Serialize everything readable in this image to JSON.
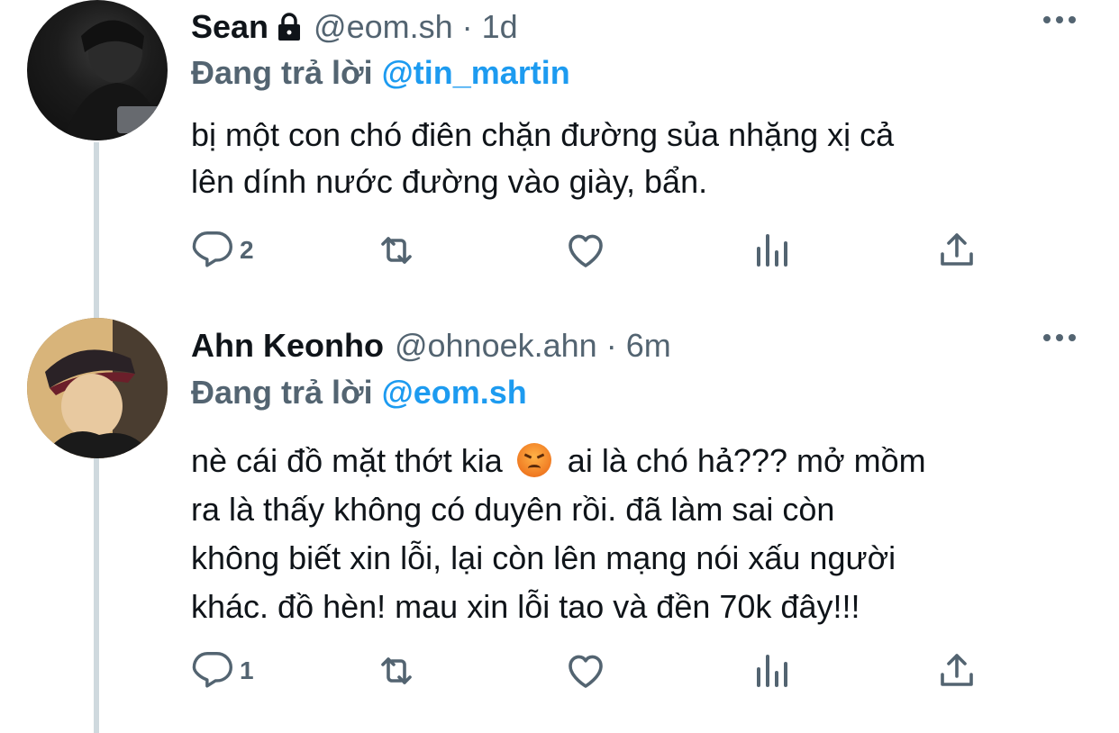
{
  "tweets": [
    {
      "name": "Sean",
      "handle": "@eom.sh",
      "separator": "·",
      "time": "1d",
      "protected": true,
      "replying_prefix": "Đang trả lời",
      "replying_to": "@tin_martin",
      "text_lines": [
        "bị một con chó điên chặn đường sủa nhặng xị cả",
        "lên dính nước đường vào giày, bẩn."
      ],
      "reply_count": "2",
      "icons": [
        "reply-icon",
        "retweet-icon",
        "like-icon",
        "views-icon",
        "share-icon",
        "more-icon",
        "lock-icon"
      ]
    },
    {
      "name": "Ahn Keonho",
      "handle": "@ohnoek.ahn",
      "separator": "·",
      "time": "6m",
      "protected": false,
      "replying_prefix": "Đang trả lời",
      "replying_to": "@eom.sh",
      "text_line1_before_emoji": "nè cái đồ mặt thớt kia",
      "emoji": "angry-face-emoji",
      "text_line1_after_emoji": "ai là chó hả??? mở mồm",
      "text_lines_rest": [
        "ra là thấy không có duyên rồi. đã làm sai còn",
        "không biết xin lỗi, lại còn lên mạng nói xấu người",
        "khác. đồ hèn! mau xin lỗi tao và đền 70k đây!!!"
      ],
      "reply_count": "1",
      "icons": [
        "reply-icon",
        "retweet-icon",
        "like-icon",
        "views-icon",
        "share-icon",
        "more-icon"
      ]
    }
  ],
  "colors": {
    "text_primary": "#0f1419",
    "text_secondary": "#536471",
    "mention_blue": "#1d9bf0",
    "thread_line": "#cfd9de"
  }
}
